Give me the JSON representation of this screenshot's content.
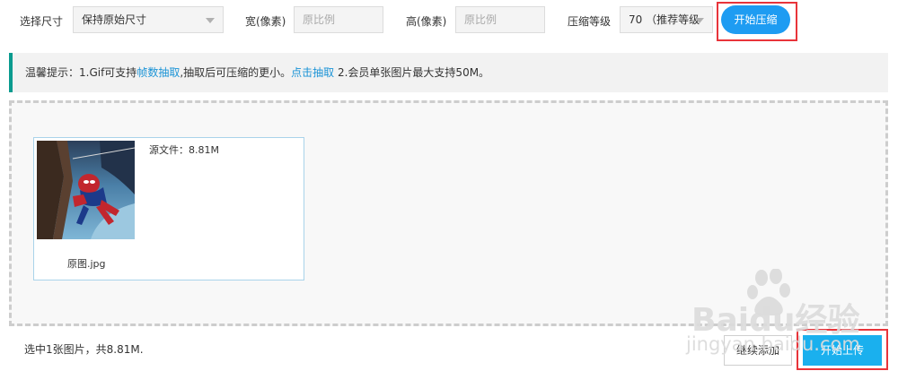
{
  "toolbar": {
    "size_label": "选择尺寸",
    "size_select_value": "保持原始尺寸",
    "width_label": "宽(像素)",
    "width_placeholder": "原比例",
    "height_label": "高(像素)",
    "height_placeholder": "原比例",
    "level_label": "压缩等级",
    "level_select_value": "70 （推荐等级",
    "compress_button": "开始压缩"
  },
  "tip": {
    "prefix": "温馨提示：1.Gif可支持",
    "link1": "帧数抽取",
    "middle": ",抽取后可压缩的更小。",
    "link2": "点击抽取",
    "suffix": " 2.会员单张图片最大支持50M。"
  },
  "file": {
    "source_size": "源文件：8.81M",
    "name": "原图.jpg"
  },
  "footer": {
    "status": "选中1张图片，共8.81M.",
    "continue_button": "继续添加",
    "upload_button": "开始上传"
  },
  "watermark": {
    "brand": "Baidu经验",
    "url": "jingyan.baidu.com"
  },
  "colors": {
    "accent_blue": "#1e9cf2",
    "upload_blue": "#1ab0ee",
    "highlight_red": "#e8343a",
    "tip_teal": "#0a9b8f",
    "link_blue": "#1a93d6"
  }
}
